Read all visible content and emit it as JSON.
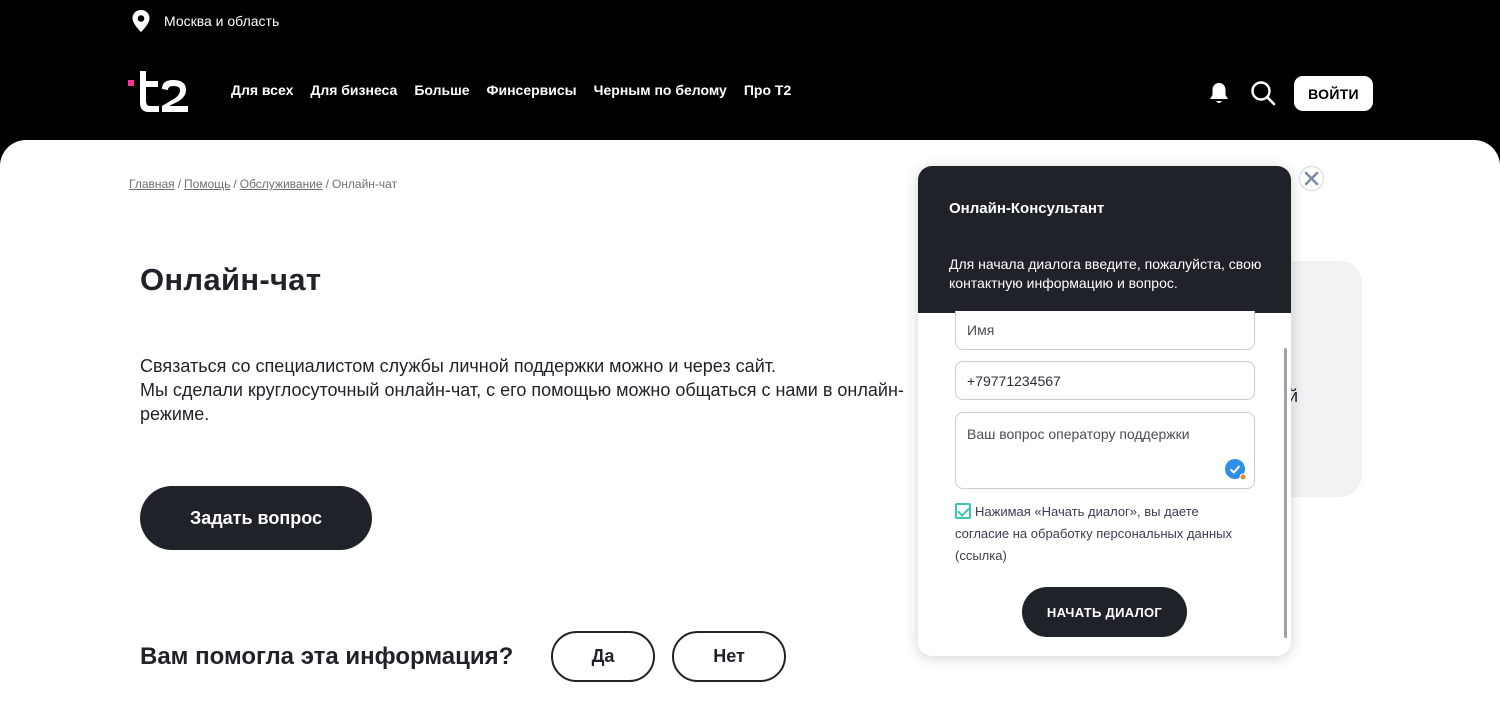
{
  "topbar": {
    "region": "Москва и область",
    "region_icon": "location-pin-icon"
  },
  "header": {
    "logo": "t2",
    "nav": [
      "Для всех",
      "Для бизнеса",
      "Больше",
      "Финсервисы",
      "Черным по белому",
      "Про T2"
    ],
    "login_label": "ВОЙТИ"
  },
  "breadcrumb": {
    "items": [
      "Главная",
      "Помощь",
      "Обслуживание"
    ],
    "current": "Онлайн-чат"
  },
  "main": {
    "title": "Онлайн-чат",
    "intro_line1": "Связаться со специалистом службы личной поддержки можно и через сайт.",
    "intro_line2": "Мы сделали круглосуточный онлайн-чат, с его помощью можно общаться с нами в онлайн-режиме.",
    "ask_button": "Задать вопрос",
    "feedback_question": "Вам помогла эта информация?",
    "feedback_yes": "Да",
    "feedback_no": "Нет",
    "side_card_fragment": "й"
  },
  "chat": {
    "title": "Онлайн-Консультант",
    "description": "Для начала диалога введите, пожалуйста, свою контактную информацию и вопрос.",
    "name_placeholder": "Имя",
    "phone_value": "+79771234567",
    "question_placeholder": "Ваш вопрос оператору поддержки",
    "consent_checked": true,
    "consent_text": "Нажимая «Начать диалог», вы даете согласие на обработку персональных данных (ссылка)",
    "start_button": "НАЧАТЬ ДИАЛОГ"
  },
  "colors": {
    "dark": "#1f2229",
    "accent_pink": "#ff3495",
    "checkbox": "#3cc6b4"
  }
}
